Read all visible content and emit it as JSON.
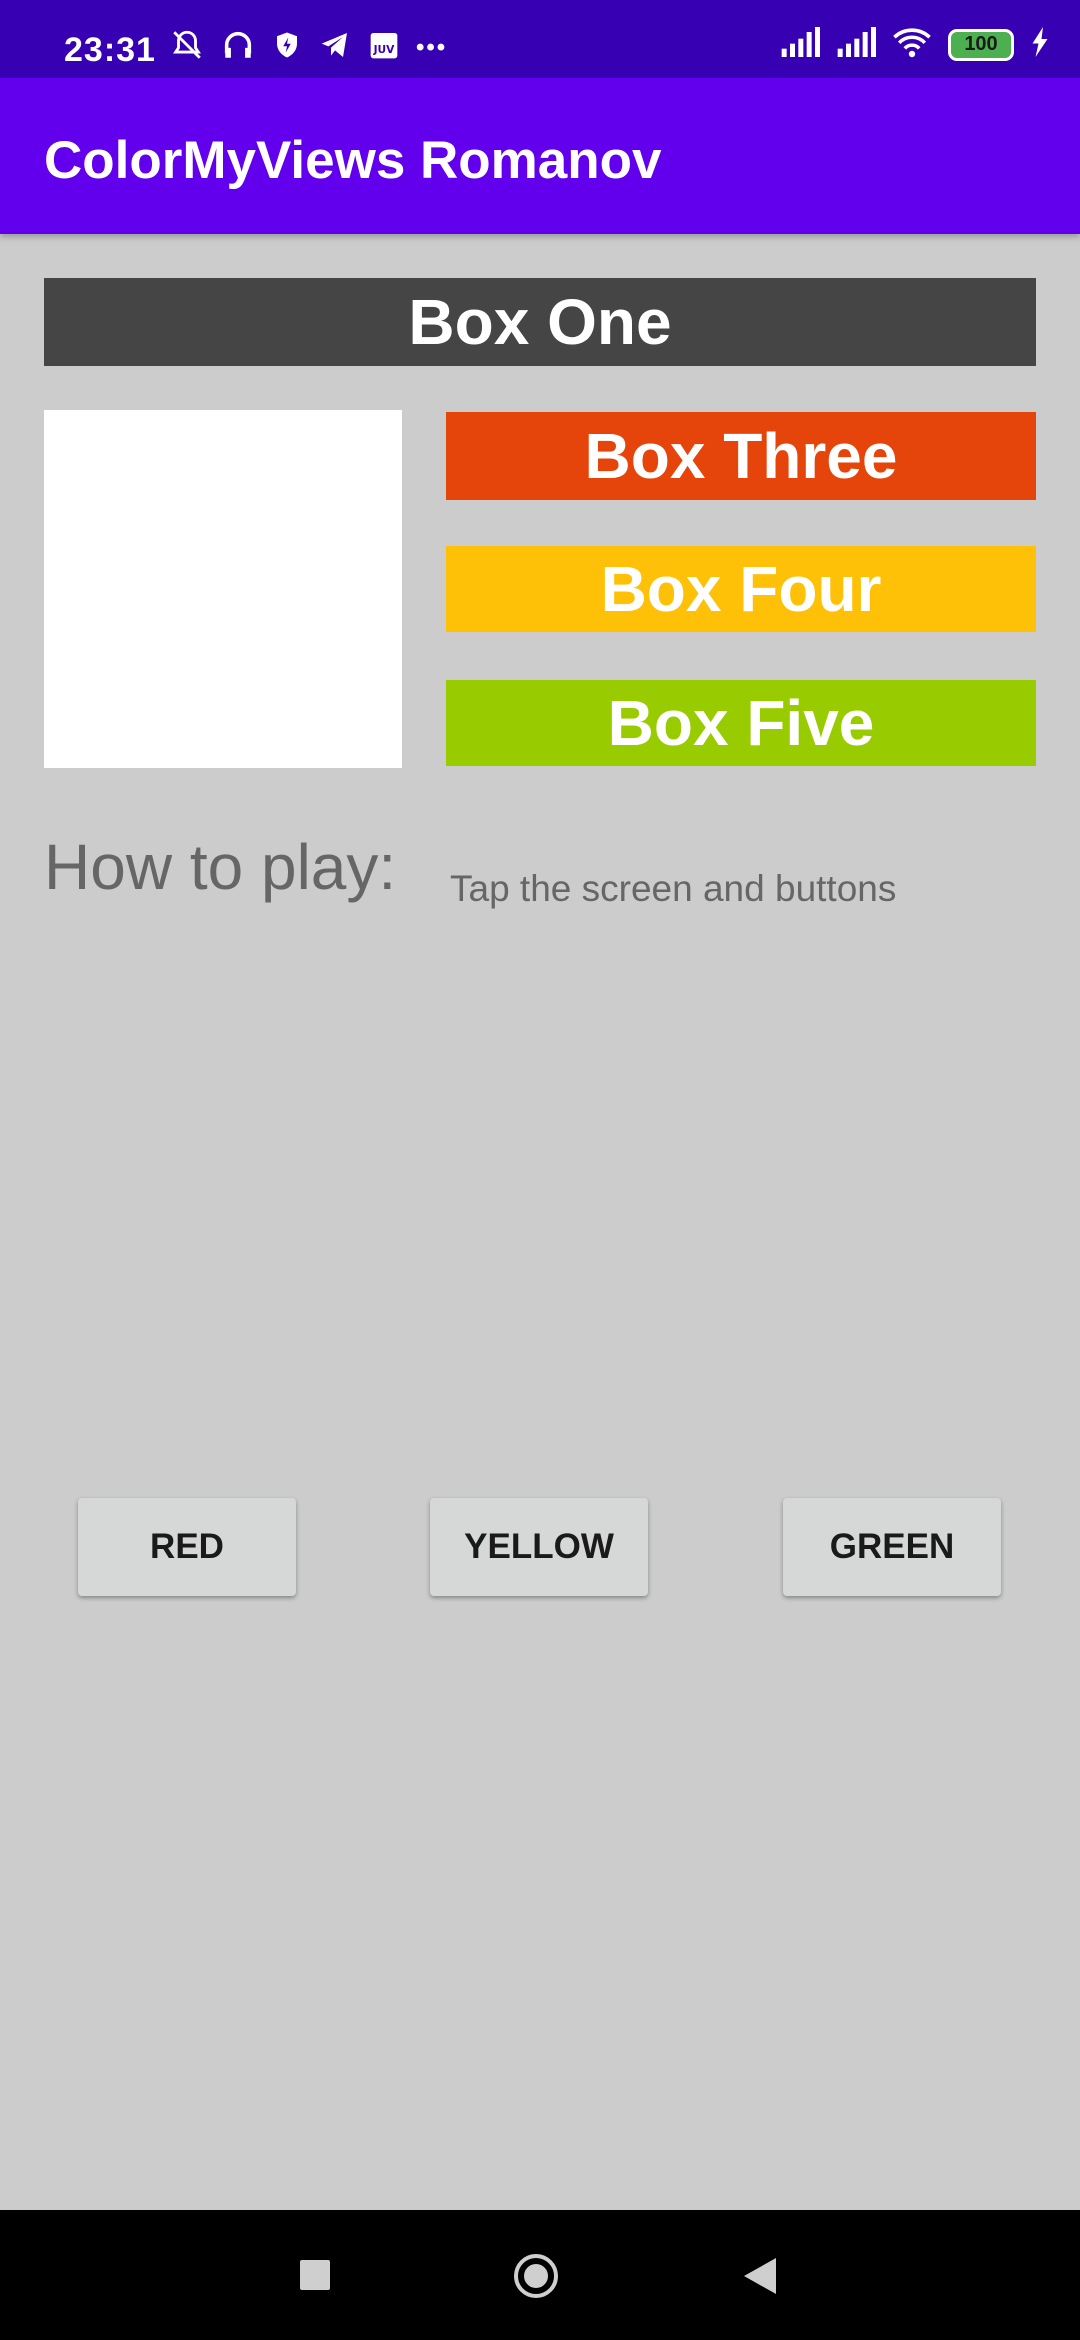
{
  "status_bar": {
    "time": "23:31",
    "left_icons": [
      "mute-bell-icon",
      "headphones-icon",
      "shield-icon",
      "telegram-icon",
      "calendar-app-icon",
      "more-dots-icon"
    ],
    "calendar_label": "JUV",
    "more": "•••",
    "right_icons": [
      "signal-icon",
      "signal-icon",
      "wifi-icon",
      "battery-icon",
      "charging-icon"
    ],
    "battery_level": "100"
  },
  "app_bar": {
    "title": "ColorMyViews Romanov"
  },
  "boxes": {
    "one": "Box One",
    "three": "Box Three",
    "four": "Box Four",
    "five": "Box Five"
  },
  "how_to": {
    "label": "How to play:",
    "text": "Tap the screen and buttons"
  },
  "buttons": {
    "red": "RED",
    "yellow": "YELLOW",
    "green": "GREEN"
  },
  "colors": {
    "status_bar": "#3700b3",
    "app_bar": "#6200ee",
    "background": "#cccccc",
    "box_one": "#454545",
    "box_two": "#ffffff",
    "box_three": "#e5440a",
    "box_four": "#ffc107",
    "box_five": "#99cc00"
  },
  "nav_bar": {
    "icons": [
      "recents-square-icon",
      "home-circle-icon",
      "back-triangle-icon"
    ]
  }
}
